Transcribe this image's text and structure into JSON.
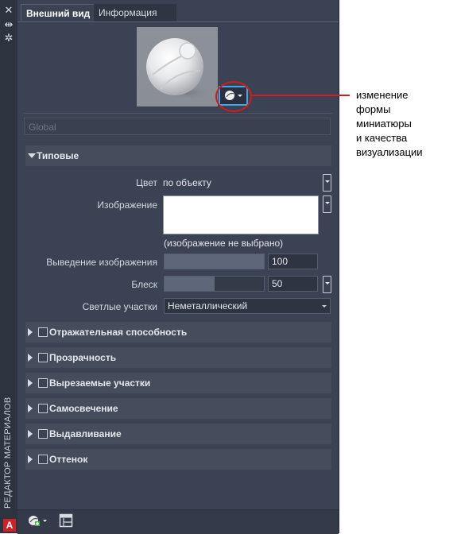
{
  "sidebar": {
    "title": "РЕДАКТОР МАТЕРИАЛОВ",
    "buttons": [
      "close-icon",
      "autohide-icon",
      "properties-icon"
    ]
  },
  "tabs": [
    {
      "label": "Внешний вид",
      "active": true
    },
    {
      "label": "Информация",
      "active": false
    }
  ],
  "preview": {
    "options_button_icon": "sphere-preview-icon"
  },
  "callout": {
    "lines": [
      "изменение",
      "формы",
      "миниатюры",
      "и качества",
      "визуализации"
    ],
    "color": "#d21c1c"
  },
  "material_name": {
    "value": "Global"
  },
  "generic": {
    "header": "Типовые",
    "color_label": "Цвет",
    "color_value": "по объекту",
    "image_label": "Изображение",
    "image_caption": "(изображение не выбрано)",
    "image_fade_label": "Выведение изображения",
    "image_fade_value": "100",
    "image_fade_fraction": 1.0,
    "glossiness_label": "Блеск",
    "glossiness_value": "50",
    "glossiness_fraction": 0.5,
    "highlights_label": "Светлые участки",
    "highlights_value": "Неметаллический"
  },
  "sections": [
    {
      "label": "Отражательная способность",
      "checked": false
    },
    {
      "label": "Прозрачность",
      "checked": false
    },
    {
      "label": "Вырезаемые участки",
      "checked": false
    },
    {
      "label": "Самосвечение",
      "checked": false
    },
    {
      "label": "Выдавливание",
      "checked": false
    },
    {
      "label": "Оттенок",
      "checked": false
    }
  ],
  "bottom": {
    "create_icon": "create-material-icon",
    "layout_icon": "panel-layout-icon"
  },
  "colors": {
    "panel_bg": "#3b4253",
    "accent": "#3fa9e8",
    "app_logo": "#d11f26"
  }
}
